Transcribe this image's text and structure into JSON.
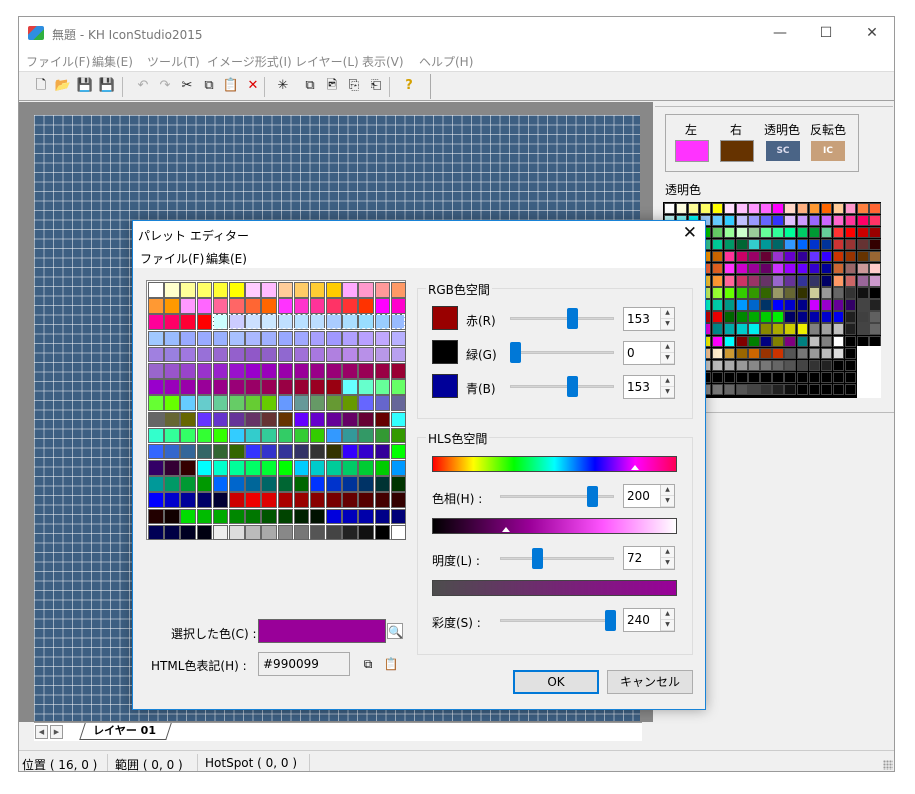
{
  "window": {
    "title": "無題 - KH IconStudio2015",
    "minimize": "—",
    "maximize": "☐",
    "close": "✕"
  },
  "menu": [
    "ファイル(F)",
    "編集(E)",
    "ツール(T)",
    "イメージ形式(I)",
    "レイヤー(L)",
    "表示(V)",
    "ヘルプ(H)"
  ],
  "toolbar": [
    {
      "name": "new-icon",
      "glyph": "🗋"
    },
    {
      "name": "open-icon",
      "glyph": "📂"
    },
    {
      "name": "save-icon",
      "glyph": "💾"
    },
    {
      "name": "save-all-icon",
      "glyph": "💾"
    },
    {
      "name": "undo-icon",
      "glyph": "↶"
    },
    {
      "name": "redo-icon",
      "glyph": "↷"
    },
    {
      "name": "cut-icon",
      "glyph": "✂"
    },
    {
      "name": "copy-icon",
      "glyph": "⧉"
    },
    {
      "name": "paste-icon",
      "glyph": "📋"
    },
    {
      "name": "delete-icon",
      "glyph": "✕"
    },
    {
      "name": "select-icon",
      "glyph": "✳"
    },
    {
      "name": "layer-copy-icon",
      "glyph": "⧉"
    },
    {
      "name": "image-icon",
      "glyph": "🖻"
    },
    {
      "name": "import-icon",
      "glyph": "⎘"
    },
    {
      "name": "export-icon",
      "glyph": "⎗"
    },
    {
      "name": "help-icon",
      "glyph": "?"
    }
  ],
  "colors": {
    "left_label": "左",
    "right_label": "右",
    "trans_label": "透明色",
    "inv_label": "反転色",
    "left": "#ff33ff",
    "right": "#663300",
    "trans_code": "SC",
    "inv_code": "IC",
    "trans_bg": "#4a6486",
    "inv_bg": "#c8a07a"
  },
  "transparent_label": "透明色",
  "layer": {
    "tab": "レイヤー 01"
  },
  "status": {
    "position": "位置 ( 16, 0 )",
    "range": "範囲 ( 0, 0 )",
    "hotspot": "HotSpot ( 0, 0 )"
  },
  "dialog": {
    "title": "パレット エディター",
    "close": "✕",
    "menu": [
      "ファイル(F)",
      "編集(E)"
    ],
    "rgb": {
      "label": "RGB色空間",
      "red_label": "赤(R)",
      "green_label": "緑(G)",
      "blue_label": "青(B)",
      "red": "153",
      "green": "0",
      "blue": "153",
      "red_fraction": 0.6,
      "green_fraction": 0.0,
      "blue_fraction": 0.6,
      "red_swatch": "#990000",
      "green_swatch": "#000000",
      "blue_swatch": "#000099"
    },
    "hls": {
      "label": "HLS色空間",
      "hue_label": "色相(H) :",
      "light_label": "明度(L) :",
      "sat_label": "彩度(S) :",
      "hue": "200",
      "light": "72",
      "sat": "240",
      "hue_fraction": 0.83,
      "light_fraction": 0.3,
      "sat_fraction": 1.0
    },
    "selected_label": "選択した色(C) :",
    "selected_color": "#990099",
    "html_label": "HTML色表記(H) :",
    "html_value": "#990099",
    "ok": "OK",
    "cancel": "キャンセル"
  }
}
